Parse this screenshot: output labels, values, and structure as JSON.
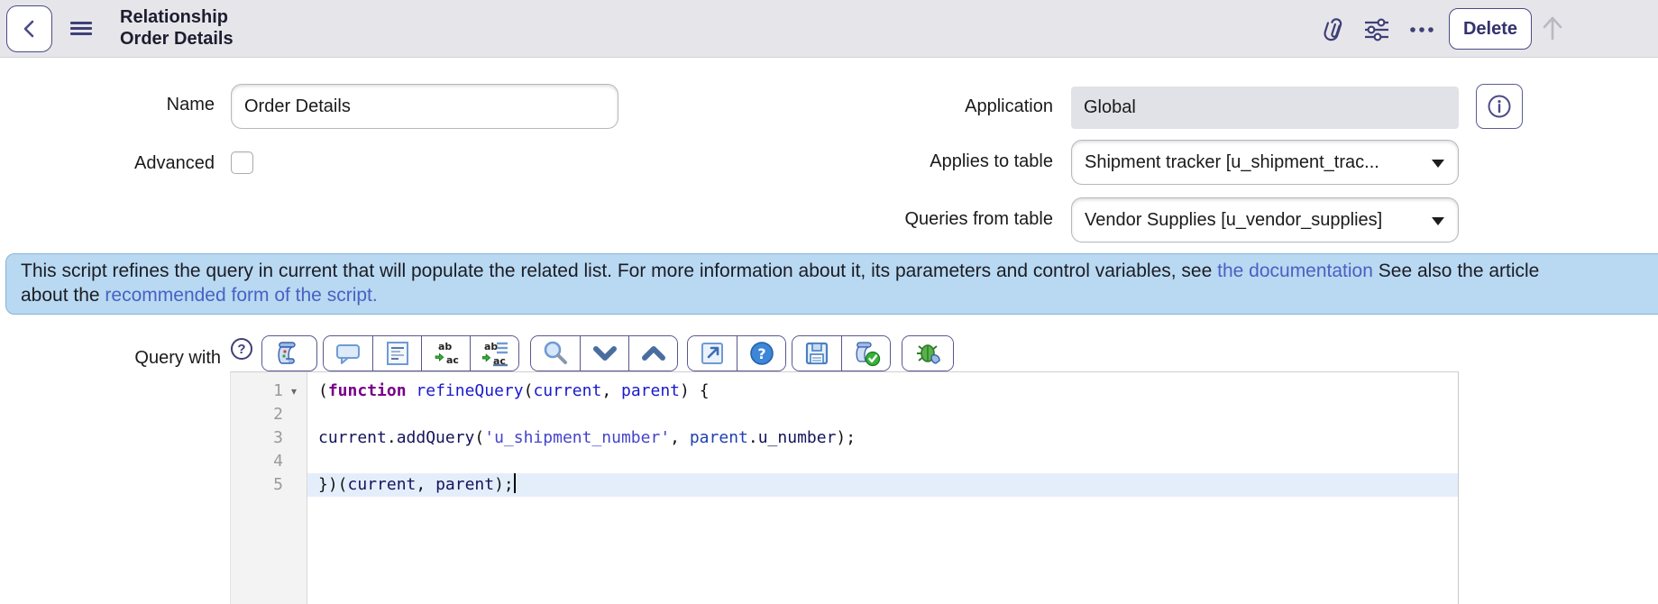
{
  "header": {
    "title_line1": "Relationship",
    "title_line2": "Order Details",
    "delete_label": "Delete",
    "icons": [
      "back-chevron-icon",
      "hamburger-icon",
      "paperclip-icon",
      "sliders-icon",
      "more-dots-icon",
      "up-arrow-icon"
    ]
  },
  "form": {
    "name": {
      "label": "Name",
      "value": "Order Details"
    },
    "application": {
      "label": "Application",
      "value": "Global",
      "readonly": true
    },
    "advanced": {
      "label": "Advanced",
      "checked": false
    },
    "applies_to_table": {
      "label": "Applies to table",
      "value": "Shipment tracker [u_shipment_trac..."
    },
    "queries_from_table": {
      "label": "Queries from table",
      "value": "Vendor Supplies [u_vendor_supplies]"
    }
  },
  "banner": {
    "line1": [
      {
        "text": "This script refines the query in current that will populate the related list. For more information about it, its parameters and control variables, see "
      },
      {
        "text": "the documentation",
        "link": true
      },
      {
        "text": " See also the article"
      }
    ],
    "line2": [
      {
        "text": "about the "
      },
      {
        "text": "recommended form of the script.",
        "link": true
      }
    ]
  },
  "script_field": {
    "label": "Query with",
    "toolbar_icons": [
      "help-outline-icon",
      "script-icon",
      "comment-icon",
      "format-code-icon",
      "replace-icon",
      "replace-all-icon",
      "search-icon",
      "chevron-down-icon",
      "chevron-up-icon",
      "open-new-window-icon",
      "help-circle-icon",
      "save-icon",
      "syntax-check-icon",
      "debug-icon"
    ],
    "editor": {
      "lines": [
        {
          "num": 1,
          "fold": true,
          "segments": [
            {
              "t": "("
            },
            {
              "t": "function",
              "c": "kw"
            },
            {
              "t": " "
            },
            {
              "t": "refineQuery",
              "c": "def"
            },
            {
              "t": "("
            },
            {
              "t": "current",
              "c": "def"
            },
            {
              "t": ", "
            },
            {
              "t": "parent",
              "c": "def"
            },
            {
              "t": ") {"
            }
          ]
        },
        {
          "num": 2,
          "segments": []
        },
        {
          "num": 3,
          "segments": [
            {
              "t": "current",
              "c": "var"
            },
            {
              "t": "."
            },
            {
              "t": "addQuery",
              "c": "var"
            },
            {
              "t": "("
            },
            {
              "t": "'u_shipment_number'",
              "c": "str"
            },
            {
              "t": ", "
            },
            {
              "t": "parent",
              "c": "var2"
            },
            {
              "t": "."
            },
            {
              "t": "u_number",
              "c": "var"
            },
            {
              "t": ");"
            }
          ]
        },
        {
          "num": 4,
          "segments": []
        },
        {
          "num": 5,
          "active": true,
          "cursor": true,
          "segments": [
            {
              "t": "})("
            },
            {
              "t": "current",
              "c": "var"
            },
            {
              "t": ", "
            },
            {
              "t": "parent",
              "c": "var"
            },
            {
              "t": ");"
            }
          ]
        }
      ]
    }
  },
  "colors": {
    "accent_navy": "#3f3f78",
    "header_bg": "#e6e6ea",
    "banner_bg": "#b8d9f1",
    "link_blue": "#4a60c4",
    "active_line": "#e4eefb",
    "keyword": "#770088",
    "definition": "#1a1acc",
    "variable": "#14145a",
    "string": "#4444cc"
  }
}
